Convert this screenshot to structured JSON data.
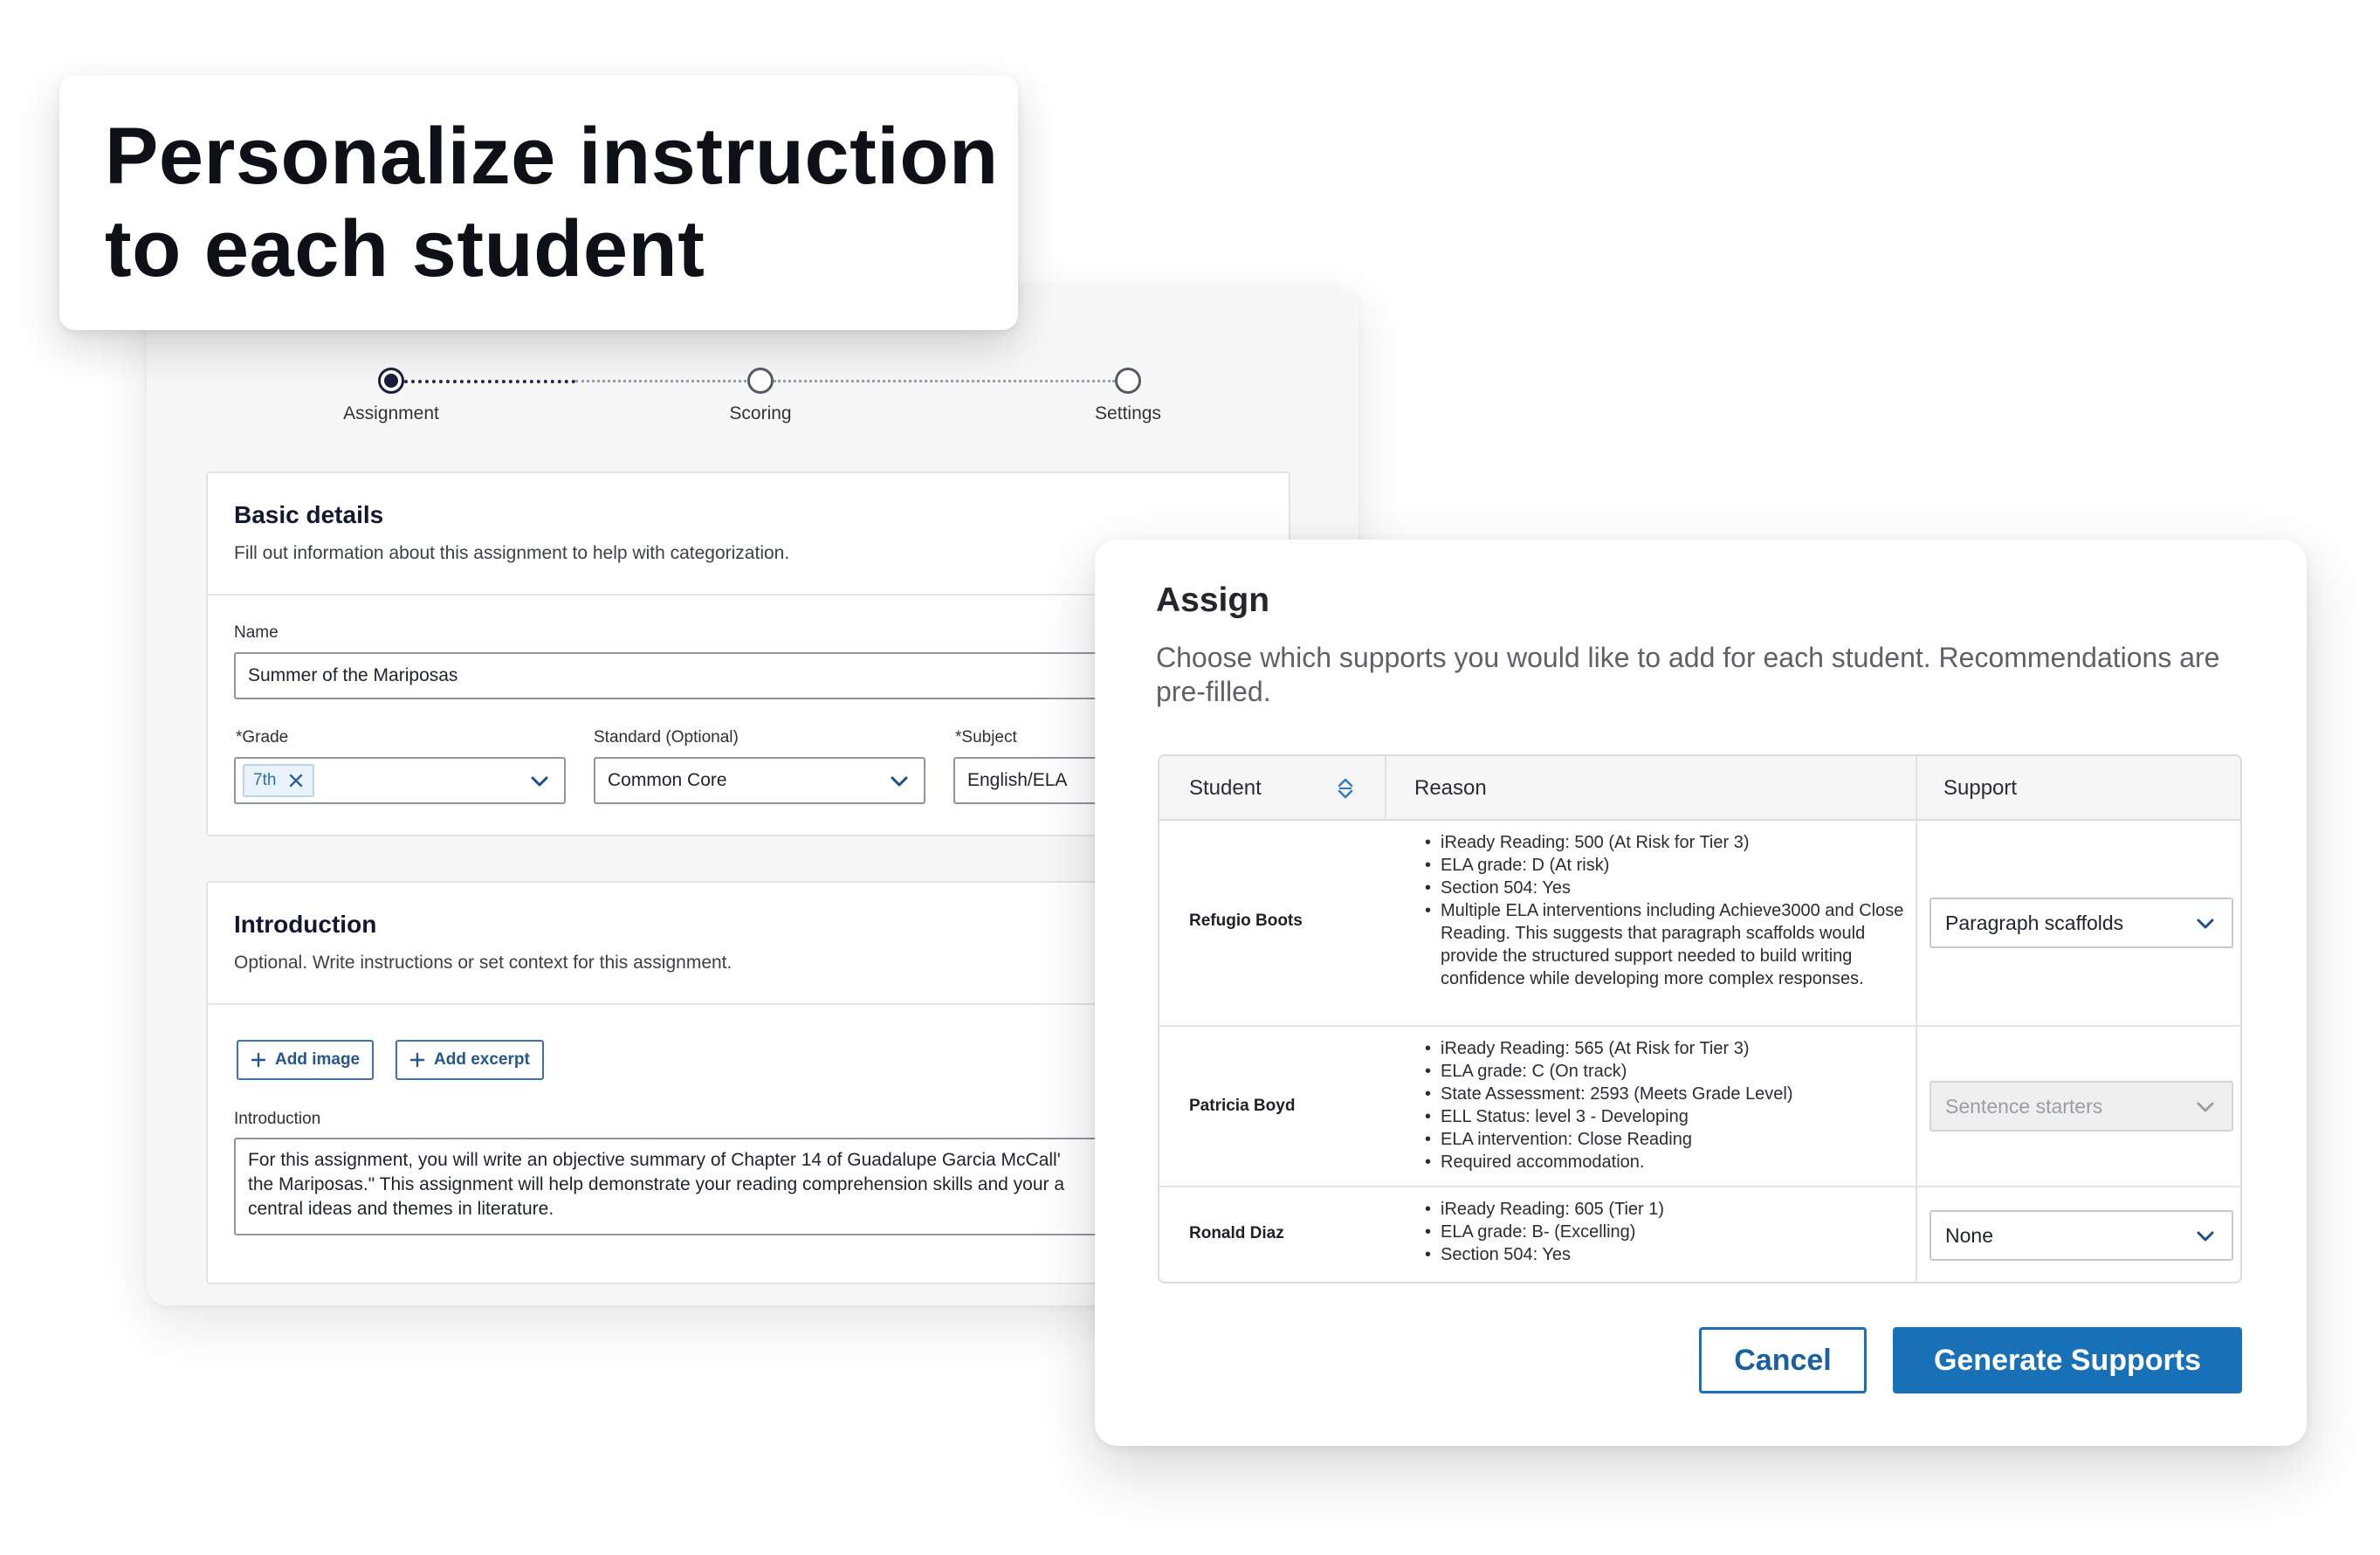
{
  "headline": "Personalize instruction to each student",
  "stepper": {
    "steps": [
      {
        "label": "Assignment",
        "state": "active"
      },
      {
        "label": "Scoring",
        "state": "upcoming"
      },
      {
        "label": "Settings",
        "state": "upcoming"
      }
    ]
  },
  "basic_details": {
    "title": "Basic details",
    "subtitle": "Fill out information about this assignment to help with categorization.",
    "name_label": "Name",
    "name_value": "Summer of the Mariposas",
    "grade_label": "*Grade",
    "grade_chip": "7th",
    "standard_label": "Standard (Optional)",
    "standard_value": "Common Core",
    "subject_label": "*Subject",
    "subject_value": "English/ELA"
  },
  "introduction": {
    "title": "Introduction",
    "subtitle": "Optional. Write instructions or set context for this assignment.",
    "add_image_label": "Add image",
    "add_excerpt_label": "Add excerpt",
    "field_label": "Introduction",
    "text": "For this assignment, you will write an objective summary of Chapter 14 of Guadalupe Garcia McCall'\nthe Mariposas.\" This assignment will help demonstrate your reading comprehension skills and your a\ncentral ideas and themes in literature."
  },
  "modal": {
    "title": "Assign",
    "description": "Choose which supports you would like to add for each student. Recommendations are pre-filled.",
    "columns": {
      "student": "Student",
      "reason": "Reason",
      "support": "Support"
    },
    "rows": [
      {
        "student": "Refugio Boots",
        "reasons": [
          "iReady Reading: 500 (At Risk for Tier 3)",
          "ELA grade: D (At risk)",
          "Section 504: Yes",
          "Multiple ELA interventions including Achieve3000 and Close Reading. This suggests that paragraph scaffolds would provide the structured support needed to build writing confidence while developing more complex responses."
        ],
        "support": "Paragraph scaffolds",
        "support_disabled": false
      },
      {
        "student": "Patricia Boyd",
        "reasons": [
          "iReady Reading: 565 (At Risk for Tier 3)",
          "ELA grade: C (On track)",
          "State Assessment: 2593 (Meets Grade Level)",
          "ELL Status: level 3 - Developing",
          "ELA intervention: Close Reading",
          "Required accommodation."
        ],
        "support": "Sentence starters",
        "support_disabled": true
      },
      {
        "student": "Ronald Diaz",
        "reasons": [
          "iReady Reading: 605 (Tier 1)",
          "ELA grade: B- (Excelling)",
          "Section 504: Yes"
        ],
        "support": "None",
        "support_disabled": false
      }
    ],
    "cancel_label": "Cancel",
    "generate_label": "Generate Supports"
  },
  "colors": {
    "primary": "#1870b6",
    "stepper_active": "#1a1d3f",
    "heading_dark": "#141733"
  }
}
